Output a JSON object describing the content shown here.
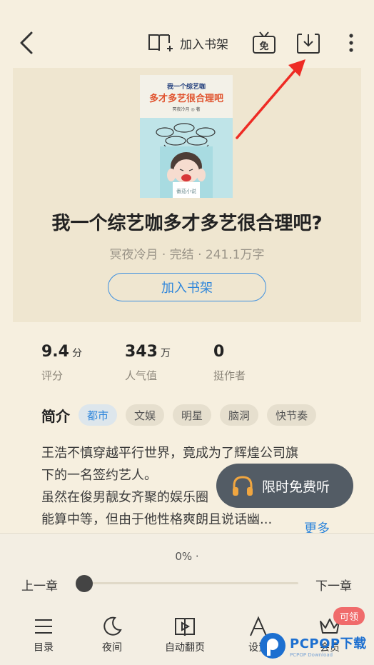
{
  "toolbar": {
    "add_shelf_label": "加入书架",
    "free_badge": "免"
  },
  "cover": {
    "series_line": "我一个综艺咖",
    "title_line": "多才多艺很合理吧",
    "author_line": "冥夜冷月 ◎ 著",
    "watermark": "番茄小说"
  },
  "book": {
    "title": "我一个综艺咖多才多艺很合理吧?",
    "meta": "冥夜冷月 · 完结 · 241.1万字",
    "add_shelf_button": "加入书架"
  },
  "stats": [
    {
      "value": "9.4",
      "unit": "分",
      "caption": "评分"
    },
    {
      "value": "343",
      "unit": "万",
      "caption": "人气值"
    },
    {
      "value": "0",
      "unit": "",
      "caption": "挺作者"
    }
  ],
  "intro": {
    "label": "简介",
    "tags": [
      "都市",
      "文娱",
      "明星",
      "脑洞",
      "快节奏"
    ],
    "lines": [
      "王浩不慎穿越平行世界，竟成为了辉煌公司旗",
      "下的一名签约艺人。",
      "虽然在俊男靓女齐聚的娱乐圈",
      "能算中等，但由于他性格爽朗且说话幽..."
    ],
    "more": "更多"
  },
  "listen": {
    "label": "限时免费听"
  },
  "reader": {
    "progress_text": "0% ·",
    "progress": 0,
    "prev": "上一章",
    "next": "下一章"
  },
  "nav": {
    "items": [
      "目录",
      "夜间",
      "自动翻页",
      "设置",
      "会员"
    ],
    "badge": "可领"
  },
  "watermark": {
    "brand": "PCPOP下载",
    "sub": "PCPOP Download"
  }
}
